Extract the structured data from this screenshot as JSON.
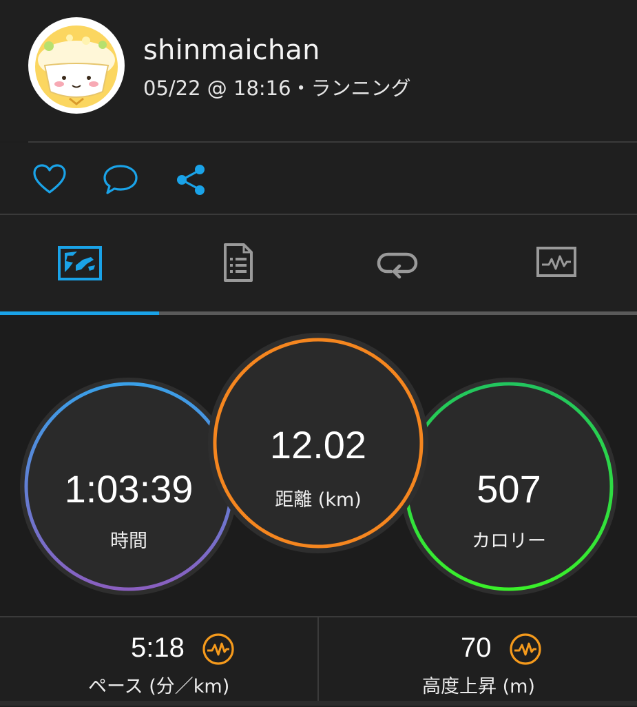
{
  "activity": {
    "user_name": "shinmaichan",
    "meta": "05/22 @ 18:16・ランニング"
  },
  "actions": {
    "like_icon": "heart-icon",
    "comment_icon": "comment-icon",
    "share_icon": "share-icon"
  },
  "tabs": {
    "items": [
      {
        "icon": "map-icon",
        "active": true
      },
      {
        "icon": "document-list-icon",
        "active": false
      },
      {
        "icon": "laps-loop-icon",
        "active": false
      },
      {
        "icon": "chart-monitor-icon",
        "active": false
      }
    ]
  },
  "stats": {
    "time": {
      "value": "1:03:39",
      "label": "時間"
    },
    "distance": {
      "value": "12.02",
      "label": "距離 (km)"
    },
    "calories": {
      "value": "507",
      "label": "カロリー"
    }
  },
  "secondary": {
    "pace": {
      "value": "5:18",
      "label": "ペース (分／km)",
      "icon": "chart-icon"
    },
    "elevation": {
      "value": "70",
      "label": "高度上昇 (m)",
      "icon": "chart-icon"
    }
  },
  "colors": {
    "accent_blue": "#1aa3e8",
    "time_ring_start": "#3aa0e8",
    "time_ring_end": "#8a5fc0",
    "distance_ring": "#f5861f",
    "calories_ring_start": "#22c55e",
    "calories_ring_end": "#3af02a",
    "chart_icon": "#f59a1c"
  }
}
